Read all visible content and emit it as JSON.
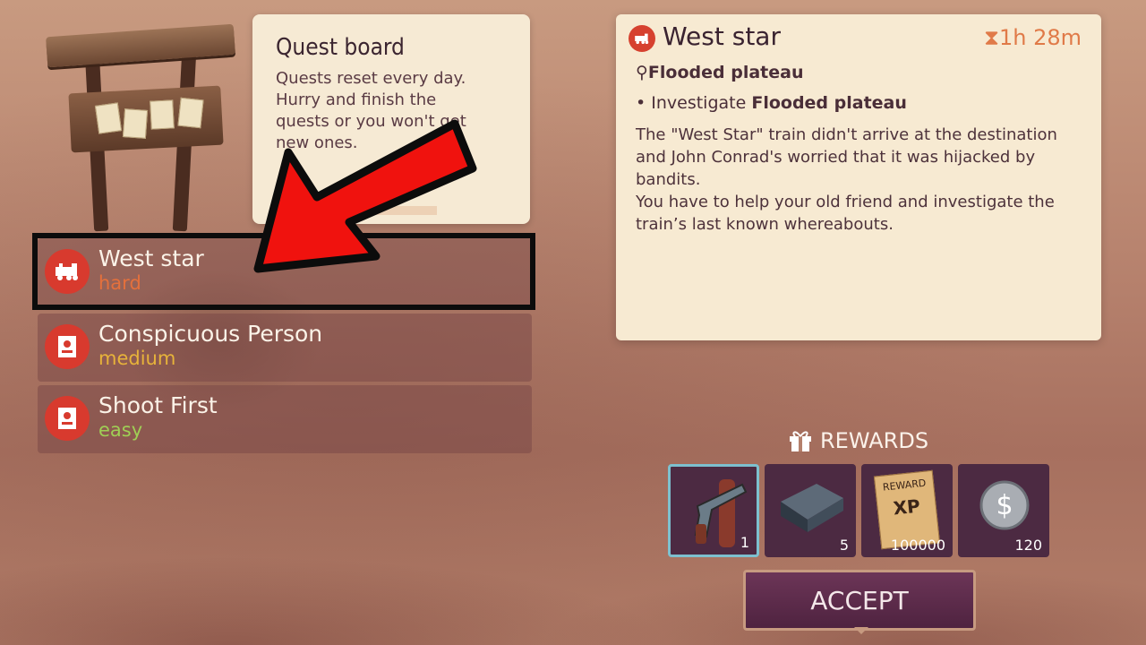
{
  "info_card": {
    "title": "Quest board",
    "body": "Quests reset every day. Hurry and finish the quests or you won't get new ones."
  },
  "quests": [
    {
      "name": "West star",
      "difficulty": "hard",
      "diff_color": "#e4703c",
      "icon": "train-icon"
    },
    {
      "name": "Conspicuous Person",
      "difficulty": "medium",
      "diff_color": "#e7b33a",
      "icon": "wanted-poster-icon"
    },
    {
      "name": "Shoot First",
      "difficulty": "easy",
      "diff_color": "#9fcf55",
      "icon": "wanted-poster-icon"
    }
  ],
  "detail": {
    "title": "West star",
    "timer": "1h 28m",
    "location": "Flooded plateau",
    "task_prefix": "Investigate ",
    "task_location": "Flooded plateau",
    "description_1": "The \"West Star\" train didn't arrive at the destination and John Conrad's worried that it was hijacked by bandits.",
    "description_2": "You have to help your old friend and investigate the train’s last known whereabouts."
  },
  "rewards": {
    "title": "REWARDS",
    "items": [
      {
        "name": "revolver",
        "count": "1",
        "selected": true
      },
      {
        "name": "iron-ingot",
        "count": "5"
      },
      {
        "name": "xp-reward",
        "count": "100000",
        "label_top": "REWARD",
        "label_mid": "XP"
      },
      {
        "name": "silver-coin",
        "count": "120"
      }
    ]
  },
  "accept_label": "ACCEPT",
  "accent_color": "#d6412f"
}
